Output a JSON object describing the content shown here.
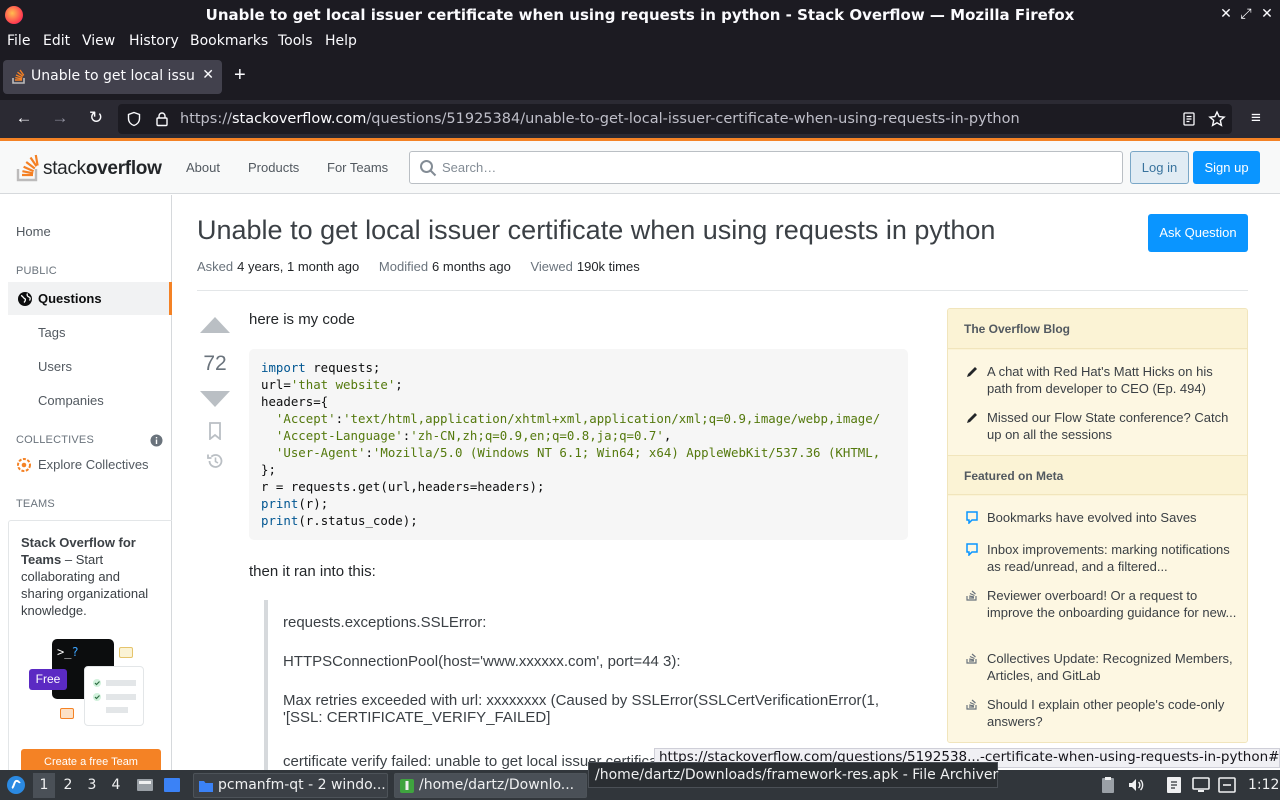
{
  "window": {
    "title": "Unable to get local issuer certificate when using requests in python - Stack Overflow — Mozilla Firefox"
  },
  "menu": [
    "File",
    "Edit",
    "View",
    "History",
    "Bookmarks",
    "Tools",
    "Help"
  ],
  "tab": {
    "label": "Unable to get local issuer certificate when using requests in python"
  },
  "url": {
    "scheme": "https://",
    "host": "stackoverflow.com",
    "path": "/questions/51925384/unable-to-get-local-issuer-certificate-when-using-requests-in-python"
  },
  "so_header": {
    "logo_plain": "stack",
    "logo_bold": "overflow",
    "nav": [
      "About",
      "Products",
      "For Teams"
    ],
    "search_placeholder": "Search…",
    "login": "Log in",
    "signup": "Sign up"
  },
  "sidebar": {
    "home": "Home",
    "public_heading": "PUBLIC",
    "questions": "Questions",
    "tags": "Tags",
    "users": "Users",
    "companies": "Companies",
    "collectives_heading": "COLLECTIVES",
    "explore_collectives": "Explore Collectives",
    "teams_heading": "TEAMS",
    "teams_title": "Stack Overflow for Teams",
    "teams_text": " – Start collaborating and sharing organizational knowledge.",
    "free_badge": "Free",
    "create_team": "Create a free Team"
  },
  "question": {
    "title": "Unable to get local issuer certificate when using requests in python",
    "ask_button": "Ask Question",
    "asked_label": "Asked",
    "asked_value": "4 years, 1 month ago",
    "modified_label": "Modified",
    "modified_value": "6 months ago",
    "viewed_label": "Viewed",
    "viewed_value": "190k times",
    "score": "72",
    "intro": "here is my code",
    "after_code": "then it ran into this:",
    "quote": [
      "requests.exceptions.SSLError:",
      "HTTPSConnectionPool(host='www.xxxxxx.com', port=44 3):",
      "Max retries exceeded with url: xxxxxxxx (Caused by SSLError(SSLCertVerificationError(1, '[SSL: CERTIFICATE_VERIFY_FAILED]",
      "certificate verify failed: unable to get local issuer certificate"
    ]
  },
  "code": {
    "l1_kw": "import",
    "l1_rest": " requests;",
    "l2_a": "url=",
    "l2_str": "'that website'",
    "l2_b": ";",
    "l3": "headers={",
    "l4_k": "'Accept'",
    "l4_v": "'text/html,application/xhtml+xml,application/xml;q=0.9,image/webp,image/",
    "l5_k": "'Accept-Language'",
    "l5_v": "'zh-CN,zh;q=0.9,en;q=0.8,ja;q=0.7'",
    "l6_k": "'User-Agent'",
    "l6_v": "'Mozilla/5.0 (Windows NT 6.1; Win64; x64) AppleWebKit/537.36 (KHTML,",
    "l7": "};",
    "l8": "r = requests.get(url,headers=headers);",
    "l9_kw": "print",
    "l9_rest": "(r);",
    "l10_kw": "print",
    "l10_rest": "(r.status_code);"
  },
  "right_sidebar": {
    "blog_heading": "The Overflow Blog",
    "blog_items": [
      "A chat with Red Hat's Matt Hicks on his path from developer to CEO (Ep. 494)",
      "Missed our Flow State conference? Catch up on all the sessions"
    ],
    "meta_heading": "Featured on Meta",
    "meta_items": [
      "Bookmarks have evolved into Saves",
      "Inbox improvements: marking notifications as read/unread, and a filtered...",
      "Reviewer overboard! Or a request to improve the onboarding guidance for new...",
      "Collectives Update: Recognized Members, Articles, and GitLab",
      "Should I explain other people's code-only answers?"
    ]
  },
  "status_url": "https://stackoverflow.com/questions/5192538...-certificate-when-using-requests-in-python#",
  "taskbar": {
    "workspaces": [
      "1",
      "2",
      "3",
      "4"
    ],
    "tasks": [
      "pcmanfm-qt - 2 windo...",
      "/home/dartz/Downlo..."
    ],
    "tooltip": "/home/dartz/Downloads/framework-res.apk - File Archiver",
    "clock": "1:12"
  }
}
